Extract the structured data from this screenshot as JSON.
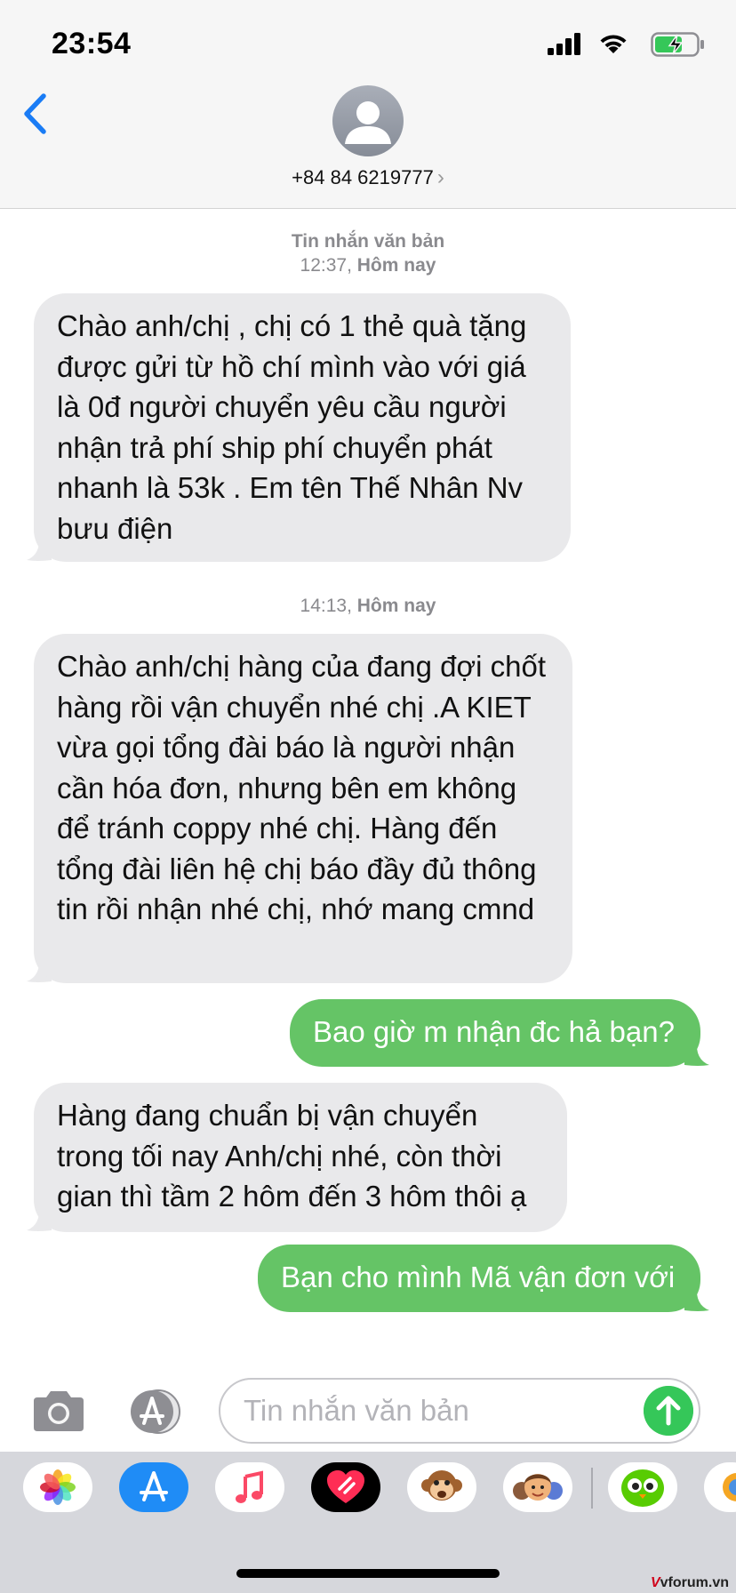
{
  "status_bar": {
    "time": "23:54"
  },
  "header": {
    "contact": "+84 84 6219777",
    "chevron": "›"
  },
  "conversation": {
    "stamp1": {
      "label": "Tin nhắn văn bản",
      "time": "12:37,",
      "day": "Hôm nay"
    },
    "stamp2": {
      "time": "14:13,",
      "day": "Hôm nay"
    },
    "messages": [
      {
        "direction": "in",
        "text": "Chào anh/chị , chị có 1 thẻ quà tặng được gửi từ hồ chí mình vào với giá là 0đ người chuyển yêu cầu người nhận trả phí ship phí chuyển phát nhanh là 53k . Em tên Thế Nhân Nv bưu điện"
      },
      {
        "direction": "in",
        "text": "Chào anh/chị hàng của đang đợi chốt hàng rồi vận chuyển nhé chị .A KIET vừa gọi tổng đài báo là người nhận cần hóa đơn, nhưng bên em không để tránh coppy nhé chị. Hàng đến tổng đài liên hệ chị báo đầy đủ thông tin rồi nhận nhé chị, nhớ mang cmnd"
      },
      {
        "direction": "out",
        "text": "Bao giờ m nhận đc hả bạn?"
      },
      {
        "direction": "in",
        "text": "Hàng đang chuẩn bị vận chuyển trong tối nay Anh/chị nhé, còn thời gian thì tầm 2 hôm đến 3 hôm thôi ạ"
      },
      {
        "direction": "out",
        "text": "Bạn cho mình Mã vận đơn với"
      }
    ]
  },
  "input": {
    "placeholder": "Tin nhắn văn bản"
  },
  "app_drawer": {
    "apps": [
      "photos-icon",
      "app-store-icon",
      "music-icon",
      "digital-touch-icon",
      "animoji-icon",
      "memoji-icon",
      "duolingo-icon",
      "more-app-icon"
    ]
  },
  "watermark": {
    "brand_v": "V",
    "brand_rest": "vforum.vn"
  },
  "colors": {
    "incoming": "#e9e9eb",
    "outgoing": "#65c466",
    "accent": "#1a7cf5"
  }
}
